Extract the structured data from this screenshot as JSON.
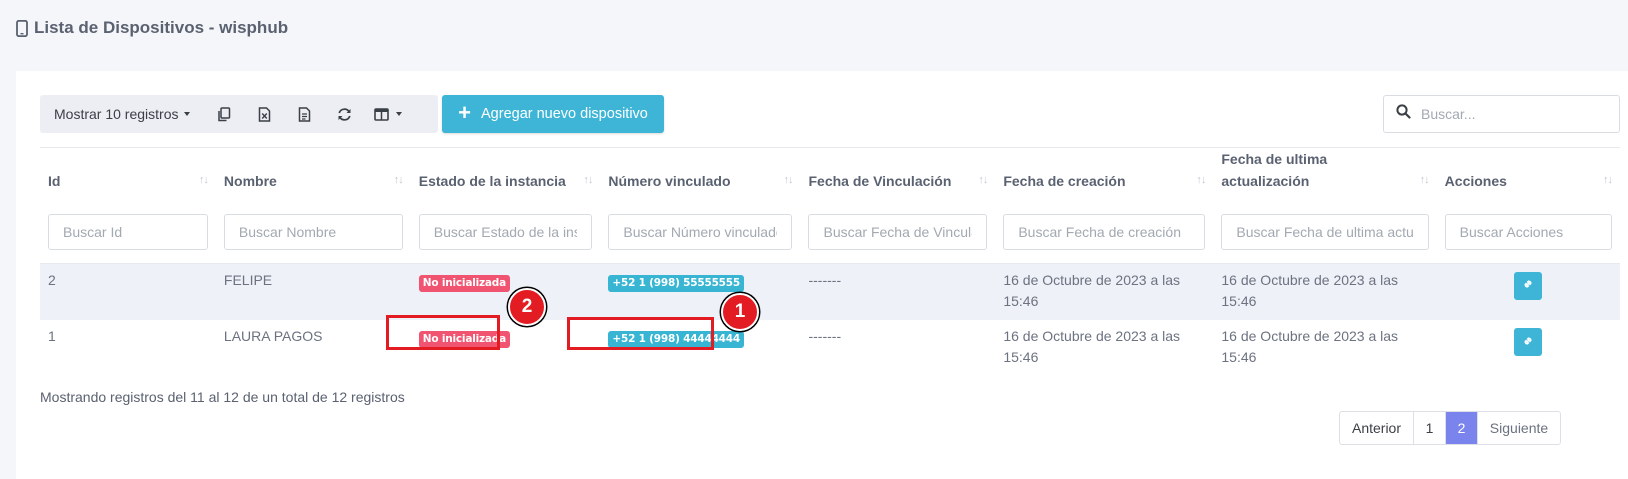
{
  "page": {
    "title": "Lista de Dispositivos - wisphub"
  },
  "toolbar": {
    "length_label": "Mostrar 10 registros",
    "add_label": "Agregar nuevo dispositivo",
    "search_placeholder": "Buscar..."
  },
  "table": {
    "columns": [
      {
        "label": "Id",
        "filter_placeholder": "Buscar Id"
      },
      {
        "label": "Nombre",
        "filter_placeholder": "Buscar Nombre"
      },
      {
        "label": "Estado de la instancia",
        "filter_placeholder": "Buscar Estado de la instancia"
      },
      {
        "label": "Número vinculado",
        "filter_placeholder": "Buscar Número vinculado"
      },
      {
        "label": "Fecha de Vinculación",
        "filter_placeholder": "Buscar Fecha de Vinculación"
      },
      {
        "label": "Fecha de creación",
        "filter_placeholder": "Buscar Fecha de creación"
      },
      {
        "label": "Fecha de ultima actualización",
        "filter_placeholder": "Buscar Fecha de ultima actualización"
      },
      {
        "label": "Acciones",
        "filter_placeholder": "Buscar Acciones"
      }
    ],
    "sort_glyph": "↑↓",
    "rows": [
      {
        "id": "2",
        "nombre": "FELIPE",
        "estado": "No inicializada",
        "numero": "+52 1 (998) 55555555",
        "fecha_vinculacion": "-------",
        "fecha_creacion": "16 de Octubre de 2023 a las 15:46",
        "fecha_actualizacion": "16 de Octubre de 2023 a las 15:46"
      },
      {
        "id": "1",
        "nombre": "LAURA PAGOS",
        "estado": "No inicializada",
        "numero": "+52 1 (998) 44444444",
        "fecha_vinculacion": "-------",
        "fecha_creacion": "16 de Octubre de 2023 a las 15:46",
        "fecha_actualizacion": "16 de Octubre de 2023 a las 15:46"
      }
    ]
  },
  "footer": {
    "info": "Mostrando registros del 11 al 12 de un total de 12 registros",
    "pagination": {
      "prev": "Anterior",
      "pages": [
        "1",
        "2"
      ],
      "current": "2",
      "next": "Siguiente"
    }
  },
  "annotations": {
    "marker_1": "1",
    "marker_2": "2"
  },
  "colors": {
    "accent": "#3eb5d6",
    "danger_badge": "#f05471",
    "info_badge": "#38b5d2",
    "active_page": "#7b83ec",
    "annotation": "#e31b23"
  },
  "icons": [
    "mobile-icon",
    "copy-icon",
    "excel-icon",
    "csv-icon",
    "refresh-icon",
    "columns-icon",
    "plus-icon",
    "search-icon",
    "link-icon"
  ]
}
